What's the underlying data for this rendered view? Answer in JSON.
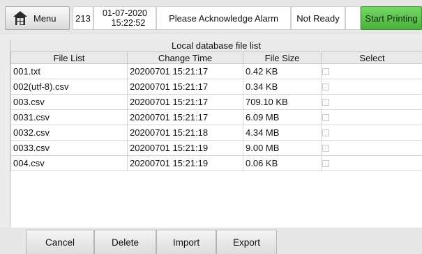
{
  "header": {
    "menu_label": "Menu",
    "job_count": "213",
    "date": "01-07-2020",
    "time": "15:22:52",
    "alarm_message": "Please Acknowledge Alarm",
    "status": "Not Ready",
    "start_label": "Start Printing"
  },
  "file_list": {
    "title": "Local database file list",
    "columns": [
      "File List",
      "Change Time",
      "File Size",
      "Select"
    ],
    "rows": [
      {
        "name": "001.txt",
        "time": "20200701 15:21:17",
        "size": "0.42 KB",
        "selected": false
      },
      {
        "name": "002(utf-8).csv",
        "time": "20200701 15:21:17",
        "size": "0.34 KB",
        "selected": false
      },
      {
        "name": "003.csv",
        "time": "20200701 15:21:17",
        "size": "709.10 KB",
        "selected": false
      },
      {
        "name": "0031.csv",
        "time": "20200701 15:21:17",
        "size": "6.09 MB",
        "selected": false
      },
      {
        "name": "0032.csv",
        "time": "20200701 15:21:18",
        "size": "4.34 MB",
        "selected": false
      },
      {
        "name": "0033.csv",
        "time": "20200701 15:21:19",
        "size": "9.00 MB",
        "selected": false
      },
      {
        "name": "004.csv",
        "time": "20200701 15:21:19",
        "size": "0.06 KB",
        "selected": false
      }
    ]
  },
  "actions": {
    "cancel": "Cancel",
    "delete": "Delete",
    "import": "Import",
    "export": "Export"
  },
  "colors": {
    "start_button": "#5cc34c",
    "panel_background": "#ffffff"
  },
  "icons": {
    "menu": "home-icon",
    "select": "checkbox-icon"
  }
}
